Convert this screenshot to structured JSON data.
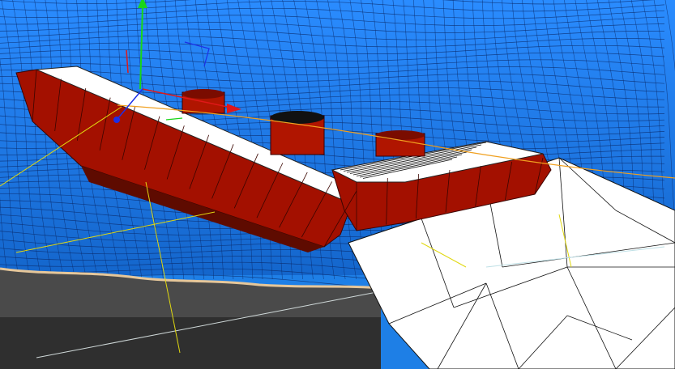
{
  "viewport": {
    "name": "3d-viewport",
    "colors": {
      "sky": "#1f80e8",
      "sky_light": "#3fa0ff",
      "wire": "#0a2a6a",
      "sea": "#2a6bb8",
      "ground": "#4d4d4d",
      "ground_dark": "#2e2e2e",
      "hull_red": "#a31000",
      "hull_dark": "#7a0c00",
      "deck_white": "#ffffff",
      "funnel_red": "#b01500",
      "iceberg": "#ffffff",
      "axis_x": "#e01818",
      "axis_y": "#19d619",
      "axis_z": "#1c2fe8",
      "guide_yellow": "#e0d810",
      "guide_orange": "#f0a020"
    },
    "objects": [
      {
        "name": "ocean-wireframe-mesh",
        "kind": "mesh"
      },
      {
        "name": "ship-hull",
        "kind": "mesh"
      },
      {
        "name": "ship-funnel",
        "kind": "mesh",
        "count": 3
      },
      {
        "name": "iceberg-mesh",
        "kind": "mesh"
      },
      {
        "name": "ground-plane",
        "kind": "plane"
      }
    ],
    "gizmo": {
      "axes": [
        "x-axis",
        "y-axis",
        "z-axis"
      ]
    }
  }
}
